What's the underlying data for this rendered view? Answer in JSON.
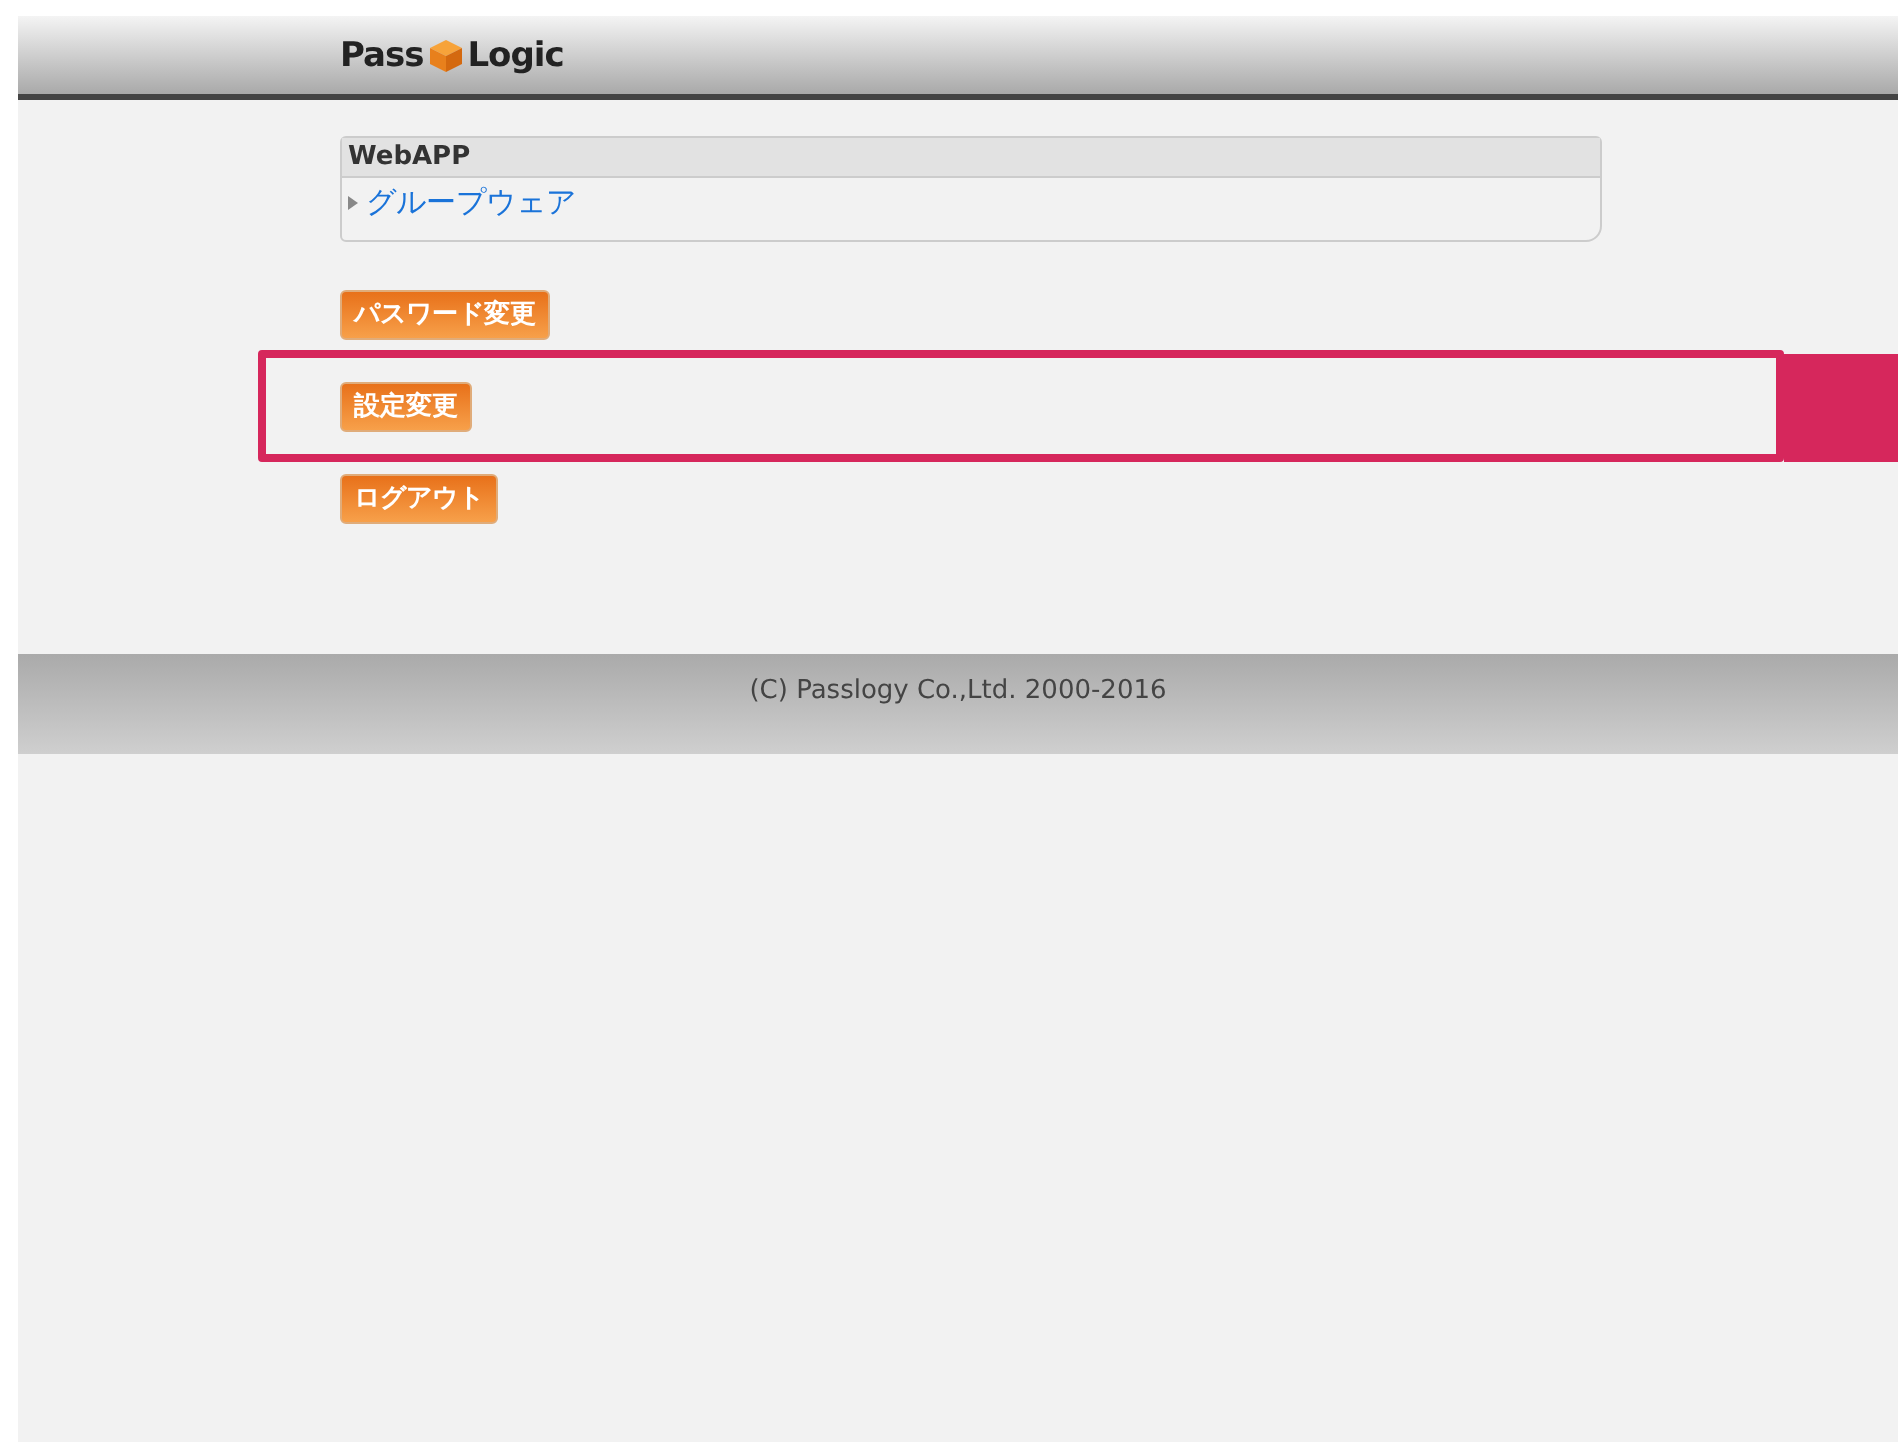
{
  "header": {
    "logo": {
      "left": "Pass",
      "right": "Logic"
    }
  },
  "webapp_panel": {
    "title": "WebAPP",
    "items": [
      {
        "label": "グループウェア"
      }
    ]
  },
  "buttons": [
    {
      "label": "パスワード変更",
      "highlighted": false
    },
    {
      "label": "設定変更",
      "highlighted": true
    },
    {
      "label": "ログアウト",
      "highlighted": false
    }
  ],
  "footer": {
    "copyright": "(C) Passlogy Co.,Ltd. 2000-2016"
  }
}
